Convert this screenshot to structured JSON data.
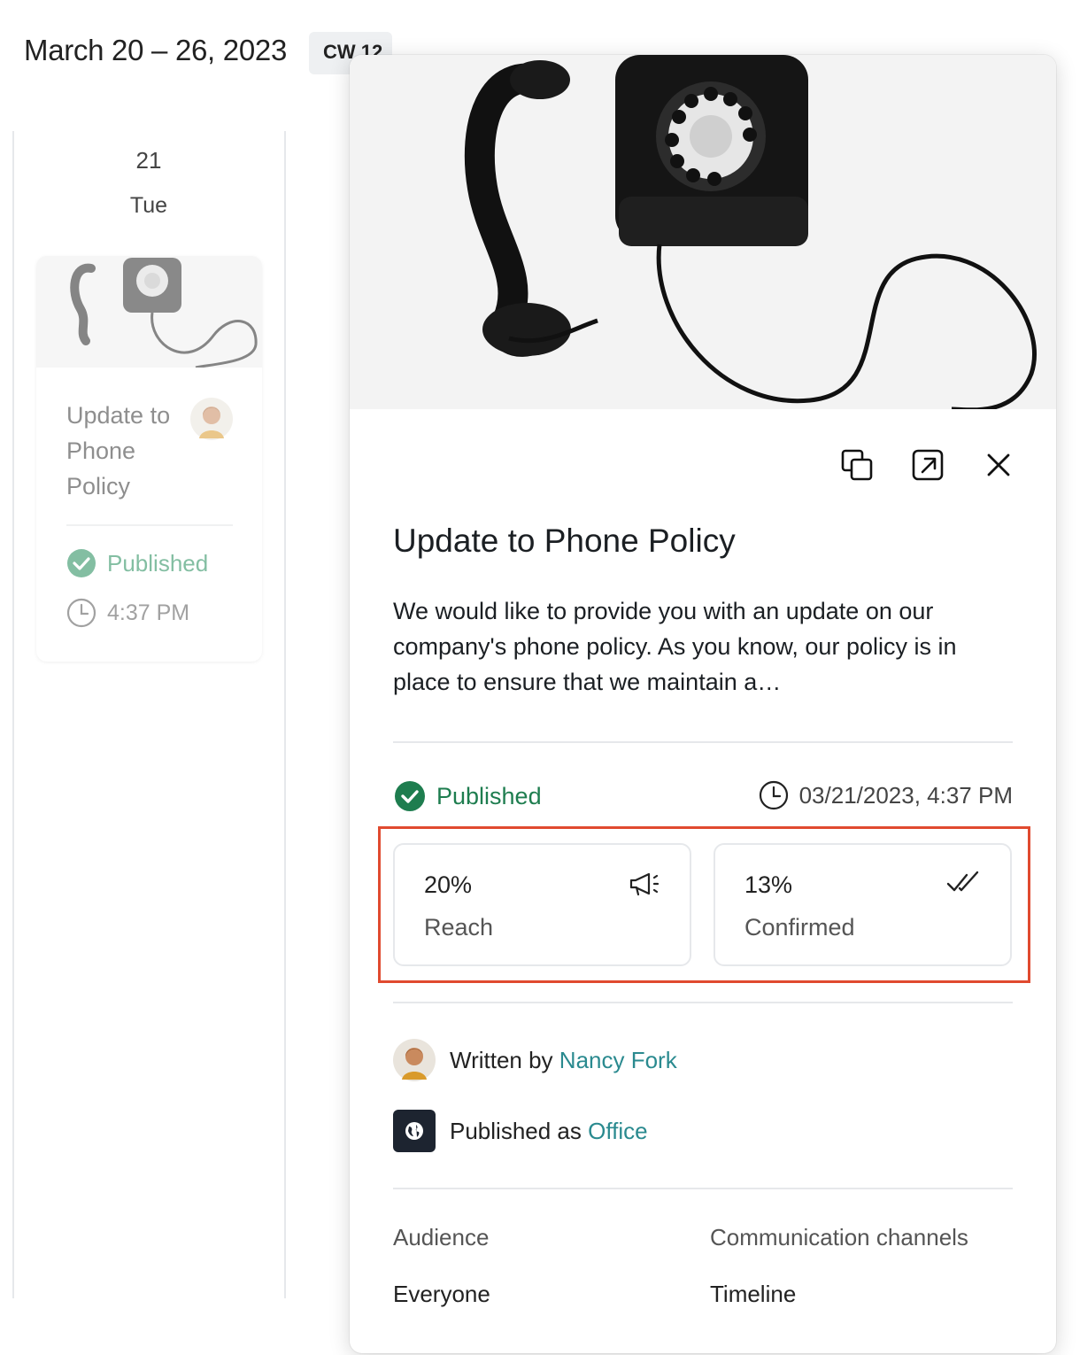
{
  "calendar": {
    "range_title": "March 20 – 26, 2023",
    "week_badge": "CW 12",
    "day_number": "21",
    "day_name": "Tue",
    "event": {
      "title": "Update to Phone Policy",
      "status": "Published",
      "time": "4:37 PM"
    }
  },
  "post": {
    "title": "Update to Phone Policy",
    "body": "We would like to provide you with an update on our company's phone policy. As you know, our policy is in place to ensure that we maintain a…",
    "status": "Published",
    "datetime": "03/21/2023, 4:37 PM",
    "stats": [
      {
        "value": "20%",
        "label": "Reach",
        "icon": "megaphone-icon"
      },
      {
        "value": "13%",
        "label": "Confirmed",
        "icon": "double-check-icon"
      }
    ],
    "author_prefix": "Written by",
    "author_name": "Nancy Fork",
    "publisher_prefix": "Published as",
    "publisher_name": "Office",
    "audience_label": "Audience",
    "audience_value": "Everyone",
    "channels_label": "Communication channels",
    "channels_value": "Timeline"
  },
  "toolbar": {
    "duplicate_icon": "duplicate-icon",
    "open_icon": "open-external-icon",
    "close_icon": "close-icon"
  },
  "colors": {
    "published_green": "#1e7d4f",
    "link_teal": "#2a8a8f",
    "highlight_red": "#e04a2f"
  }
}
